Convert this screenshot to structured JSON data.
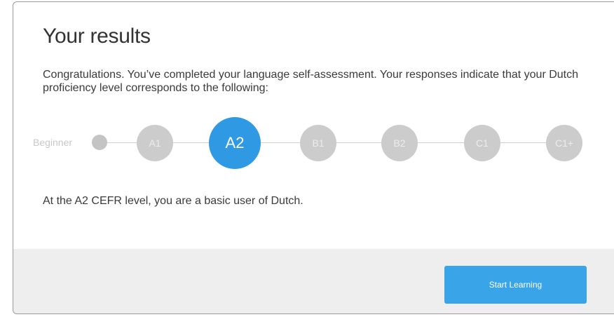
{
  "page": {
    "title": "Your results",
    "intro": "Congratulations. You’ve completed your language self-assessment. Your responses indicate that your Dutch proficiency level corresponds to the following:",
    "summary": "At the A2 CEFR level, you are a basic user of Dutch."
  },
  "scale": {
    "start_label": "Beginner",
    "selected": "A2",
    "levels": [
      "A1",
      "A2",
      "B1",
      "B2",
      "C1",
      "C1+"
    ]
  },
  "footer": {
    "start_button_label": "Start Learning"
  },
  "colors": {
    "accent": "#2f9ae3",
    "inactive_level": "#cccccc",
    "footer_bg": "#eeeeee"
  }
}
